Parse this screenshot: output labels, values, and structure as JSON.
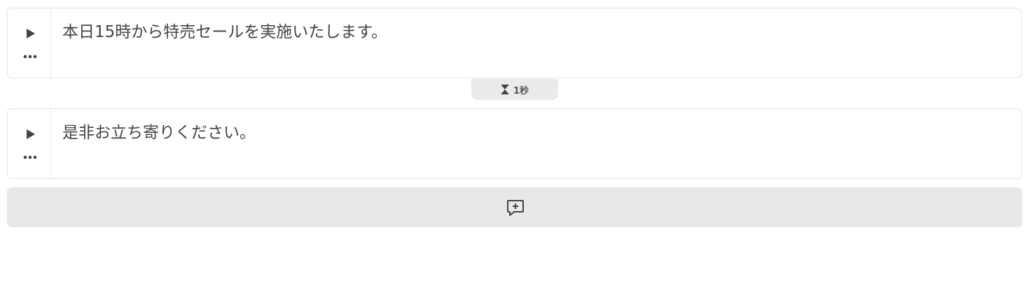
{
  "blocks": [
    {
      "text": "本日15時から特売セールを実施いたします。",
      "play_icon": "play-icon",
      "more_icon": "more-horizontal-icon"
    },
    {
      "text": "是非お立ち寄りください。",
      "play_icon": "play-icon",
      "more_icon": "more-horizontal-icon"
    }
  ],
  "pause": {
    "icon": "hourglass-icon",
    "label": "1秒"
  },
  "add_bar": {
    "icon": "comment-add-icon"
  },
  "colors": {
    "text": "#444444",
    "border": "#e3e3e3",
    "chip_bg": "#ebebeb",
    "add_bar_bg": "#e8e8e8"
  }
}
